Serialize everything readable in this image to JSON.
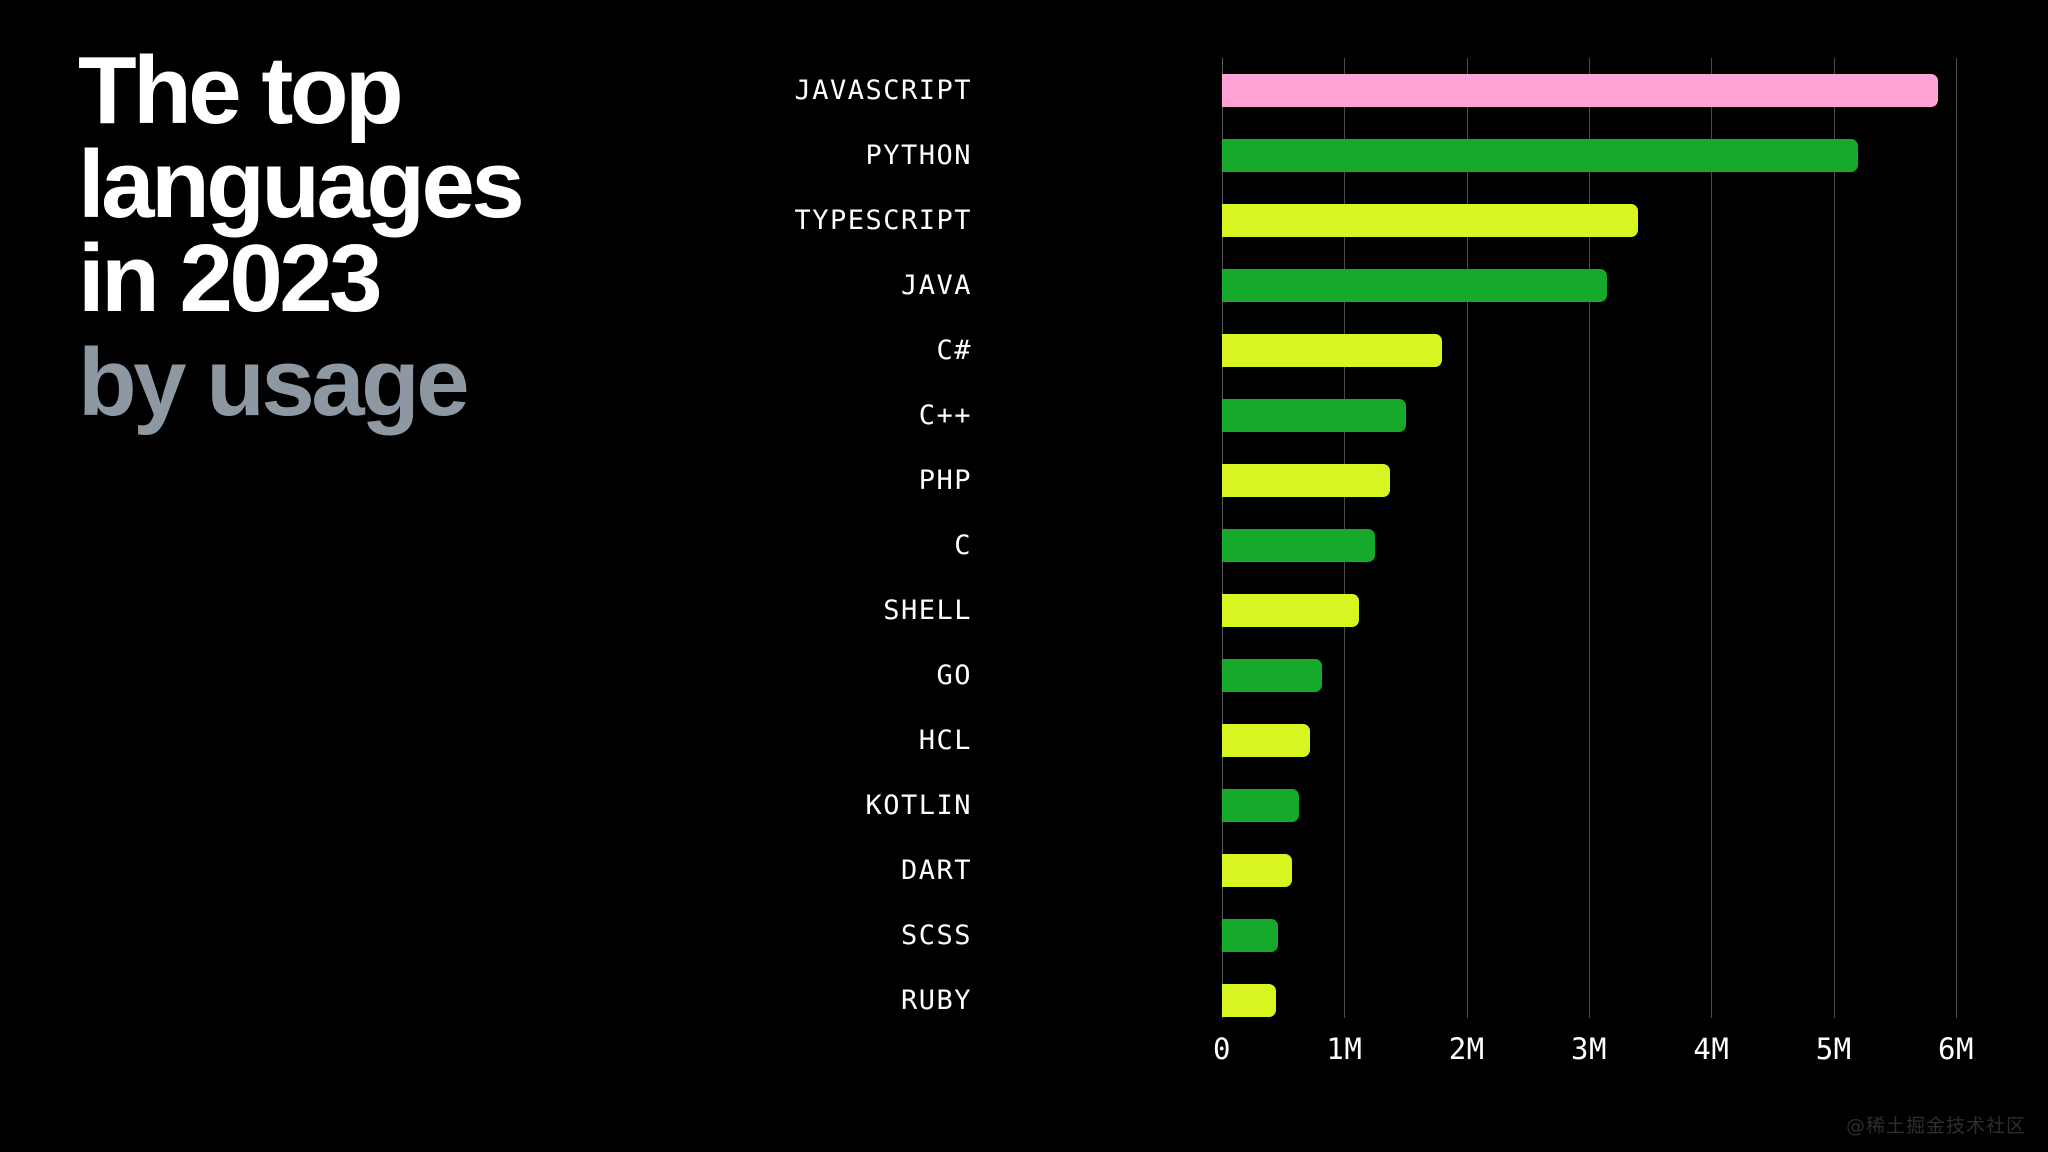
{
  "theme": {
    "background": "#000000",
    "title_color": "#ffffff",
    "subtitle_color": "#8d98a3",
    "grid_color": "#4a4a4a",
    "tick_color": "#ffffff",
    "label_color": "#ffffff",
    "watermark_color": "#2e2e2e"
  },
  "headline": {
    "line1": "The top",
    "line2": "languages",
    "line3": "in 2023",
    "line4": "by usage"
  },
  "watermark": {
    "text": "@稀土掘金技术社区"
  },
  "chart_data": {
    "type": "bar",
    "orientation": "horizontal",
    "title": "The top languages in 2023 by usage",
    "xlabel": "",
    "ylabel": "",
    "xlim": [
      0,
      6000000
    ],
    "grid": true,
    "legend": "none",
    "xticks": [
      0,
      1000000,
      2000000,
      3000000,
      4000000,
      5000000,
      6000000
    ],
    "xtick_labels": [
      "0",
      "1M",
      "2M",
      "3M",
      "4M",
      "5M",
      "6M"
    ],
    "categories": [
      "JAVASCRIPT",
      "PYTHON",
      "TYPESCRIPT",
      "JAVA",
      "C#",
      "C++",
      "PHP",
      "C",
      "SHELL",
      "GO",
      "HCL",
      "KOTLIN",
      "DART",
      "SCSS",
      "RUBY"
    ],
    "values": [
      5850000,
      5200000,
      3400000,
      3150000,
      1800000,
      1500000,
      1370000,
      1250000,
      1120000,
      820000,
      720000,
      630000,
      570000,
      460000,
      440000
    ],
    "colors": [
      "#ffa3d7",
      "#16a92c",
      "#d9f521",
      "#16a92c",
      "#d9f521",
      "#16a92c",
      "#d9f521",
      "#16a92c",
      "#d9f521",
      "#16a92c",
      "#d9f521",
      "#16a92c",
      "#d9f521",
      "#16a92c",
      "#d9f521"
    ],
    "palette": {
      "pink": "#ffa3d7",
      "green": "#16a92c",
      "lime": "#d9f521"
    }
  }
}
